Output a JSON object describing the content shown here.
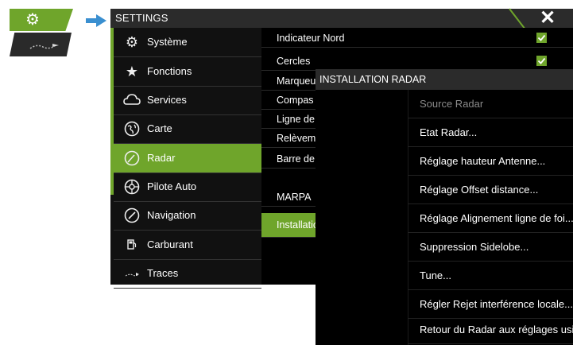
{
  "window": {
    "title": "SETTINGS",
    "close_symbol": "✕"
  },
  "sidebar": {
    "items": [
      {
        "label": "Système",
        "icon": "gear-icon"
      },
      {
        "label": "Fonctions",
        "icon": "star-icon"
      },
      {
        "label": "Services",
        "icon": "cloud-icon"
      },
      {
        "label": "Carte",
        "icon": "globe-icon"
      },
      {
        "label": "Radar",
        "icon": "radar-icon",
        "active": true
      },
      {
        "label": "Pilote Auto",
        "icon": "steering-wheel-icon"
      },
      {
        "label": "Navigation",
        "icon": "compass-icon"
      },
      {
        "label": "Carburant",
        "icon": "fuel-pump-icon"
      },
      {
        "label": "Traces",
        "icon": "track-icon"
      }
    ]
  },
  "radar_settings": {
    "rows": [
      {
        "label": "Indicateur Nord",
        "checked": true
      },
      {
        "label": "Cercles",
        "checked": true
      },
      {
        "label": "Marqueu"
      },
      {
        "label": "Compas"
      },
      {
        "label": "Ligne de d"
      },
      {
        "label": "Relèveme"
      },
      {
        "label": "Barre de d"
      },
      {
        "label": "MARPA"
      },
      {
        "label": "Installatio",
        "active": true
      }
    ]
  },
  "dialog": {
    "title": "INSTALLATION RADAR",
    "options": [
      {
        "label": "Source Radar",
        "enabled": false
      },
      {
        "label": "Etat Radar...",
        "enabled": true
      },
      {
        "label": "Réglage hauteur Antenne...",
        "enabled": true
      },
      {
        "label": "Réglage Offset distance...",
        "enabled": true
      },
      {
        "label": "Réglage Alignement ligne de foi...",
        "enabled": true
      },
      {
        "label": "Suppression Sidelobe...",
        "enabled": true
      },
      {
        "label": "Tune...",
        "enabled": true
      },
      {
        "label": "Régler Rejet interférence locale...",
        "enabled": true
      },
      {
        "label": "Retour du Radar aux réglages usine.",
        "enabled": true
      }
    ]
  },
  "colors": {
    "accent": "#6fa52b",
    "arrow": "#3a8fd0",
    "titlebar": "#2b2b2b",
    "background": "#000000"
  }
}
